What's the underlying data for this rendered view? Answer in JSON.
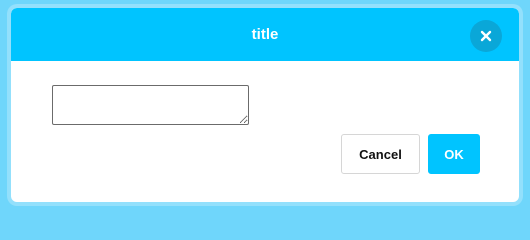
{
  "dialog": {
    "title": "title",
    "close_icon": "close-icon",
    "input": {
      "value": "",
      "placeholder": ""
    },
    "buttons": {
      "cancel_label": "Cancel",
      "ok_label": "OK"
    }
  },
  "colors": {
    "accent": "#00c4ff",
    "backdrop": "#6fd6fb",
    "close_button_bg": "#0aa7d8"
  }
}
